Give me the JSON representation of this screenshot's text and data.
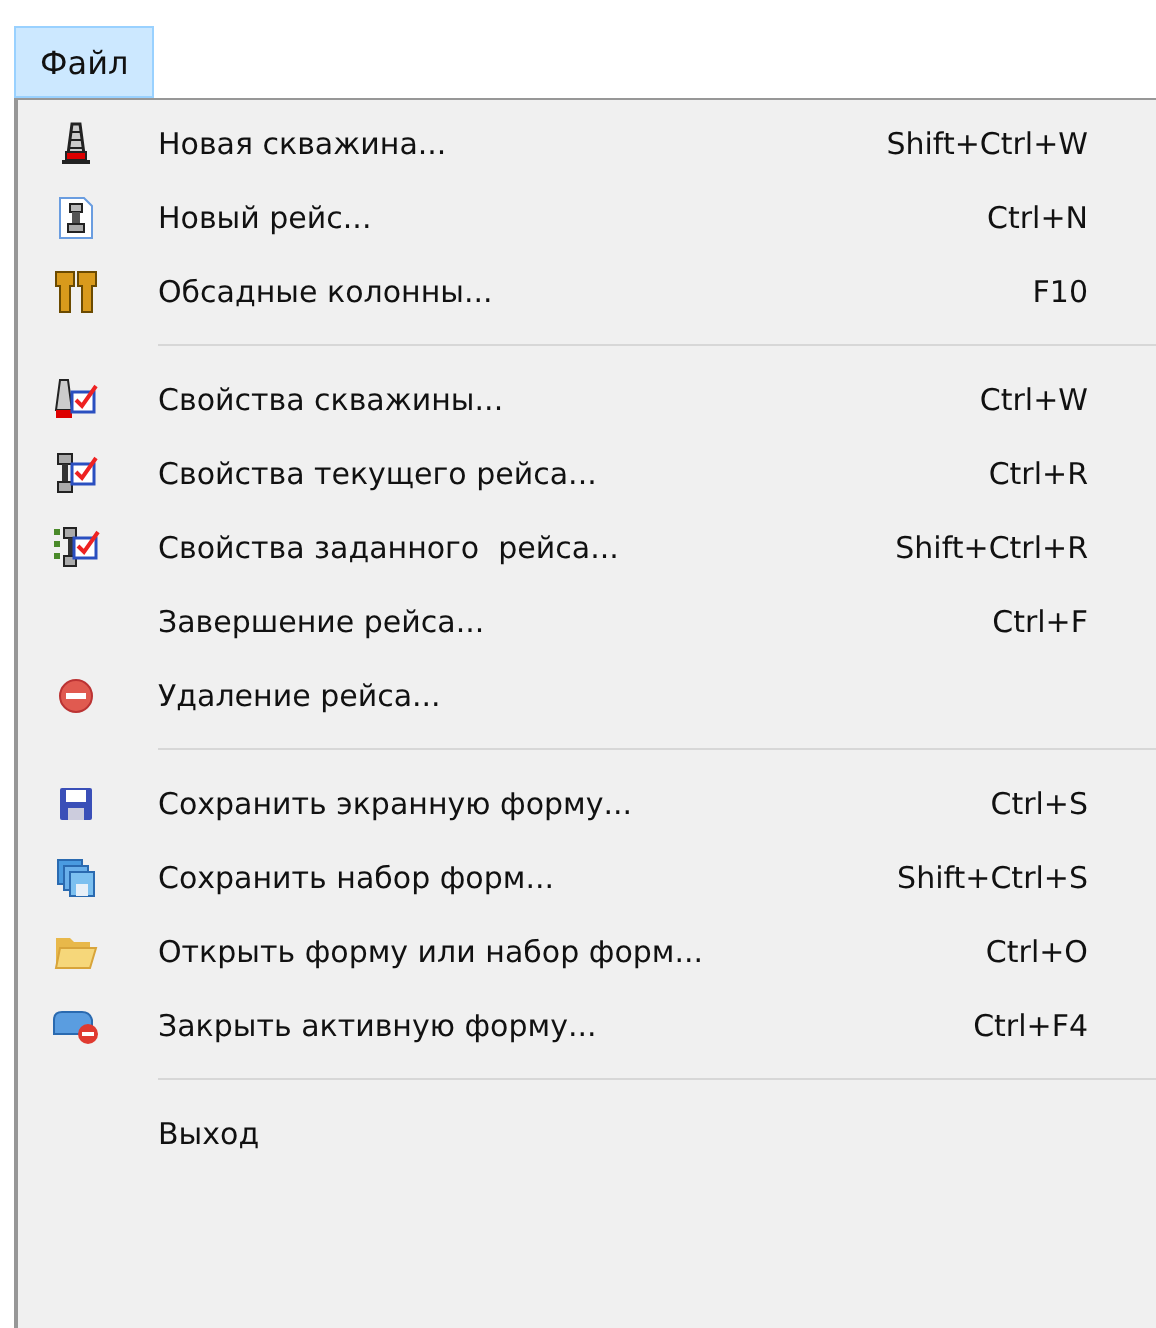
{
  "menu_bar": [
    {
      "label": "Файл",
      "selected": true
    }
  ],
  "menu": [
    {
      "kind": "item",
      "label": "Новая скважина...",
      "shortcut": "Shift+Ctrl+W"
    },
    {
      "kind": "item",
      "label": "Новый рейс...",
      "shortcut": "Ctrl+N"
    },
    {
      "kind": "item",
      "label": "Обсадные колонны...",
      "shortcut": "F10"
    },
    {
      "kind": "separator"
    },
    {
      "kind": "item",
      "label": "Свойства скважины...",
      "shortcut": "Ctrl+W"
    },
    {
      "kind": "item",
      "label": "Свойства текущего рейса...",
      "shortcut": "Ctrl+R"
    },
    {
      "kind": "item",
      "label": "Свойства заданного  рейса...",
      "shortcut": "Shift+Ctrl+R"
    },
    {
      "kind": "item",
      "label": "Завершение рейса...",
      "shortcut": "Ctrl+F"
    },
    {
      "kind": "item",
      "label": "Удаление рейса..."
    },
    {
      "kind": "separator"
    },
    {
      "kind": "item",
      "label": "Сохранить экранную форму...",
      "shortcut": "Ctrl+S"
    },
    {
      "kind": "item",
      "label": "Сохранить набор форм...",
      "shortcut": "Shift+Ctrl+S"
    },
    {
      "kind": "item",
      "label": "Открыть форму или набор форм...",
      "shortcut": "Ctrl+O"
    },
    {
      "kind": "item",
      "label": "Закрыть активную форму...",
      "shortcut": "Ctrl+F4"
    },
    {
      "kind": "separator"
    },
    {
      "kind": "item",
      "label": "Выход"
    }
  ]
}
